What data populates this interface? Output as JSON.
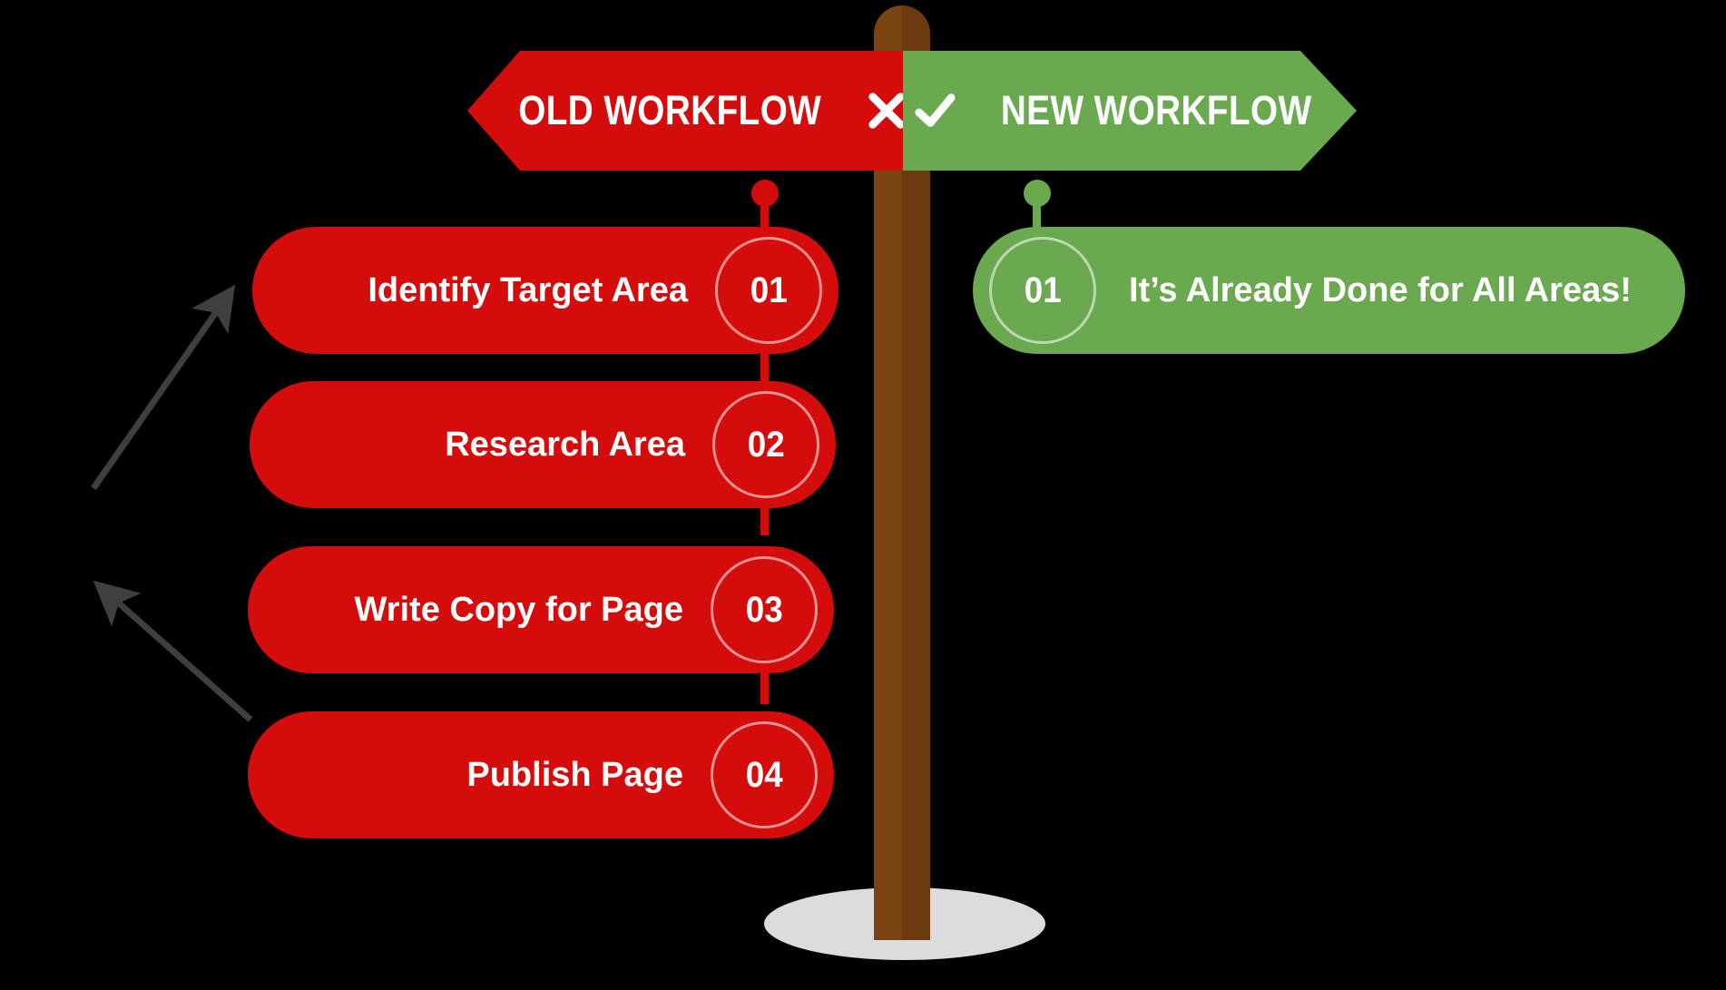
{
  "signs": {
    "old": {
      "label": "OLD WORKFLOW",
      "icon": "cross-icon",
      "color": "#d40c0c"
    },
    "new": {
      "label": "NEW WORKFLOW",
      "icon": "check-icon",
      "color": "#6ba950"
    }
  },
  "post": {
    "color": "#7a4312",
    "shadow_color": "#dcdcdc"
  },
  "old_workflow": {
    "steps": [
      {
        "number": "01",
        "label": "Identify Target Area"
      },
      {
        "number": "02",
        "label": "Research Area"
      },
      {
        "number": "03",
        "label": "Write Copy for Page"
      },
      {
        "number": "04",
        "label": "Publish Page"
      }
    ]
  },
  "new_workflow": {
    "steps": [
      {
        "number": "01",
        "label": "It’s Already Done for All Areas!"
      }
    ]
  },
  "annotations": {
    "arrow_color": "#3f3f3f",
    "arrows": [
      {
        "name": "arrow-to-identify-target-area"
      },
      {
        "name": "arrow-to-write-copy-for-page"
      }
    ]
  }
}
